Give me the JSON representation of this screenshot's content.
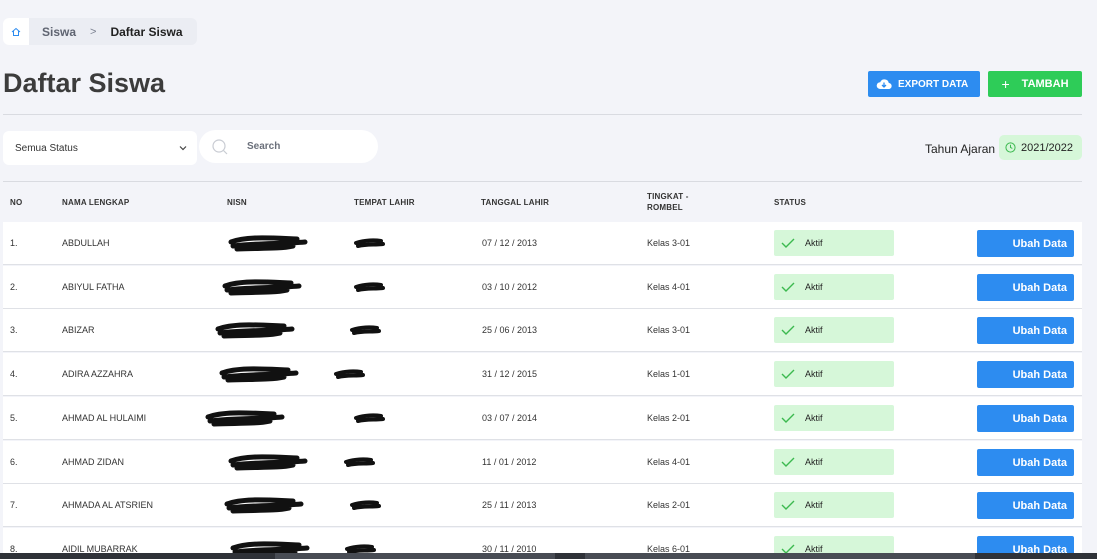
{
  "breadcrumb": {
    "items": [
      "Siswa",
      "Daftar Siswa"
    ],
    "separator": ">"
  },
  "page": {
    "title": "Daftar Siswa"
  },
  "toolbar": {
    "export_label": "EXPORT DATA",
    "add_label": "TAMBAH",
    "add_symbol": "+"
  },
  "filters": {
    "status_value": "Semua Status",
    "search_placeholder": "Search",
    "year_label": "Tahun Ajaran",
    "year_value": "2021/2022"
  },
  "table": {
    "headers": {
      "no": "NO",
      "name": "NAMA LENGKAP",
      "nisn": "NISN",
      "birthplace": "TEMPAT LAHIR",
      "birthdate": "TANGGAL LAHIR",
      "grade_line1": "TINGKAT -",
      "grade_line2": "ROMBEL",
      "status": "STATUS"
    },
    "rows": [
      {
        "no": "1.",
        "name": "ABDULLAH",
        "date": "07 / 12 / 2013",
        "kelas": "Kelas 3-01",
        "status": "Aktif",
        "action": "Ubah Data"
      },
      {
        "no": "2.",
        "name": "ABIYUL  FATHA",
        "date": "03 / 10 / 2012",
        "kelas": "Kelas 4-01",
        "status": "Aktif",
        "action": "Ubah Data"
      },
      {
        "no": "3.",
        "name": "ABIZAR",
        "date": "25 / 06 / 2013",
        "kelas": "Kelas 3-01",
        "status": "Aktif",
        "action": "Ubah Data"
      },
      {
        "no": "4.",
        "name": "ADIRA AZZAHRA",
        "date": "31 / 12 / 2015",
        "kelas": "Kelas 1-01",
        "status": "Aktif",
        "action": "Ubah Data"
      },
      {
        "no": "5.",
        "name": "AHMAD AL HULAIMI",
        "date": "03 / 07 / 2014",
        "kelas": "Kelas 2-01",
        "status": "Aktif",
        "action": "Ubah Data"
      },
      {
        "no": "6.",
        "name": "AHMAD ZIDAN",
        "date": "11 / 01 / 2012",
        "kelas": "Kelas 4-01",
        "status": "Aktif",
        "action": "Ubah Data"
      },
      {
        "no": "7.",
        "name": "AHMADA AL ATSRIEN",
        "date": "25 / 11 / 2013",
        "kelas": "Kelas 2-01",
        "status": "Aktif",
        "action": "Ubah Data"
      },
      {
        "no": "8.",
        "name": "AIDIL MUBARRAK",
        "date": "30 / 11 / 2010",
        "kelas": "Kelas 6-01",
        "status": "Aktif",
        "action": "Ubah Data"
      }
    ]
  },
  "colors": {
    "primary": "#2d8cf0",
    "success": "#2ecc58",
    "status_bg": "#d6f7d9",
    "check": "#3cb94f"
  }
}
